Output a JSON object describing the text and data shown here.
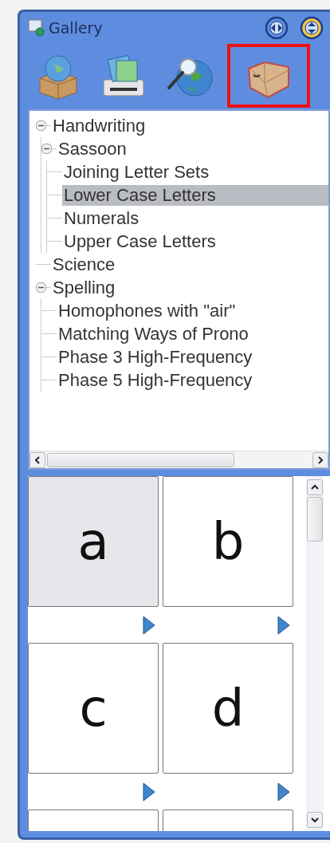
{
  "window": {
    "title": "Gallery"
  },
  "toolbar": [
    {
      "kind": "globe-box",
      "selected": false
    },
    {
      "kind": "photo-printer",
      "selected": false
    },
    {
      "kind": "globe-search",
      "selected": false
    },
    {
      "kind": "open-box",
      "selected": true
    }
  ],
  "tree": [
    {
      "label": "Handwriting",
      "expanded": true,
      "selected": false,
      "children": [
        {
          "label": "Sassoon",
          "expanded": true,
          "selected": false,
          "children": [
            {
              "label": "Joining Letter Sets",
              "selected": false
            },
            {
              "label": "Lower Case Letters",
              "selected": true
            },
            {
              "label": "Numerals",
              "selected": false
            },
            {
              "label": "Upper Case Letters",
              "selected": false
            }
          ]
        }
      ]
    },
    {
      "label": "Science",
      "selected": false
    },
    {
      "label": "Spelling",
      "expanded": true,
      "selected": false,
      "children": [
        {
          "label": "Homophones with \"air\"",
          "selected": false
        },
        {
          "label": "Matching Ways of Prono",
          "selected": false
        },
        {
          "label": "Phase 3 High-Frequency",
          "selected": false
        },
        {
          "label": "Phase 5 High-Frequency",
          "selected": false
        }
      ]
    }
  ],
  "gallery": [
    {
      "letter": "a",
      "selected": true
    },
    {
      "letter": "b",
      "selected": false
    },
    {
      "letter": "c",
      "selected": false
    },
    {
      "letter": "d",
      "selected": false
    },
    {
      "selected": false
    },
    {
      "selected": false
    }
  ]
}
